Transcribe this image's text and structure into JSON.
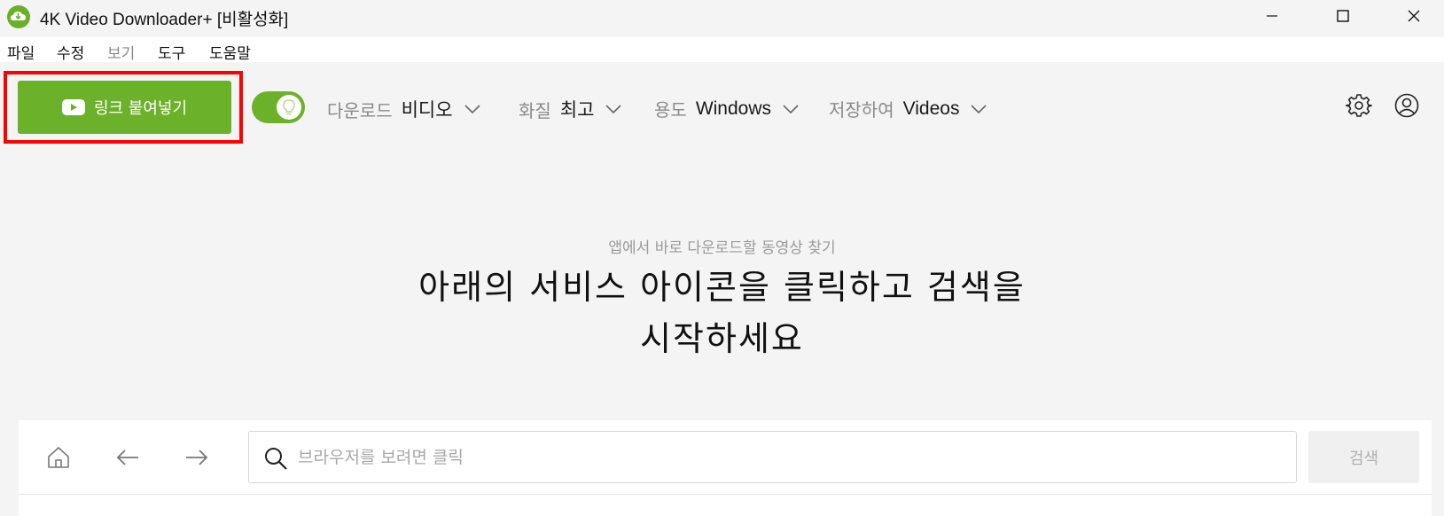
{
  "window": {
    "title": "4K Video Downloader+ [비활성화]"
  },
  "menu": {
    "items": [
      {
        "label": "파일"
      },
      {
        "label": "수정"
      },
      {
        "label": "보기"
      },
      {
        "label": "도구"
      },
      {
        "label": "도움말"
      }
    ]
  },
  "toolbar": {
    "paste_label": "링크 붙여넣기",
    "smart_mode_on": true,
    "download": {
      "label": "다운로드",
      "value": "비디오"
    },
    "quality": {
      "label": "화질",
      "value": "최고"
    },
    "purpose": {
      "label": "용도",
      "value": "Windows"
    },
    "save": {
      "label": "저장하여",
      "value": "Videos"
    }
  },
  "main": {
    "subtitle": "앱에서 바로 다운로드할 동영상 찾기",
    "headline_line1": "아래의 서비스 아이콘을 클릭하고 검색을",
    "headline_line2": "시작하세요"
  },
  "browser": {
    "search_placeholder": "브라우저를 보려면 클릭",
    "search_value": "",
    "search_button": "검색"
  },
  "colors": {
    "accent": "#6cb12a",
    "highlight": "#ff0000"
  }
}
